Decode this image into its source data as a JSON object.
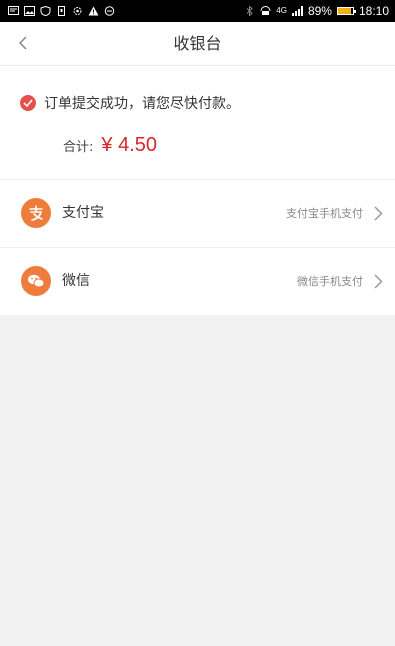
{
  "status_bar": {
    "battery": "89%",
    "battery_level": 0.89,
    "time": "18:10",
    "network": "4G",
    "left_icons": [
      "message-icon",
      "image-icon",
      "shield-icon",
      "phone-icon",
      "settings-icon",
      "warning-icon",
      "dnd-icon"
    ],
    "right_icons": [
      "bluetooth-icon",
      "hd-icon",
      "signal-icon",
      "battery-icon"
    ]
  },
  "header": {
    "title": "收银台"
  },
  "order": {
    "success_message": "订单提交成功，请您尽快付款。",
    "total_label": "合计:",
    "total_amount": "¥ 4.50"
  },
  "payment_methods": [
    {
      "name": "支付宝",
      "description": "支付宝手机支付",
      "icon": "alipay-icon"
    },
    {
      "name": "微信",
      "description": "微信手机支付",
      "icon": "wechat-icon"
    }
  ],
  "colors": {
    "accent": "#e4504b",
    "price": "#d9262b",
    "pay_icon_bg": "#ee7d3d",
    "page_bg": "#f2f2f2"
  }
}
